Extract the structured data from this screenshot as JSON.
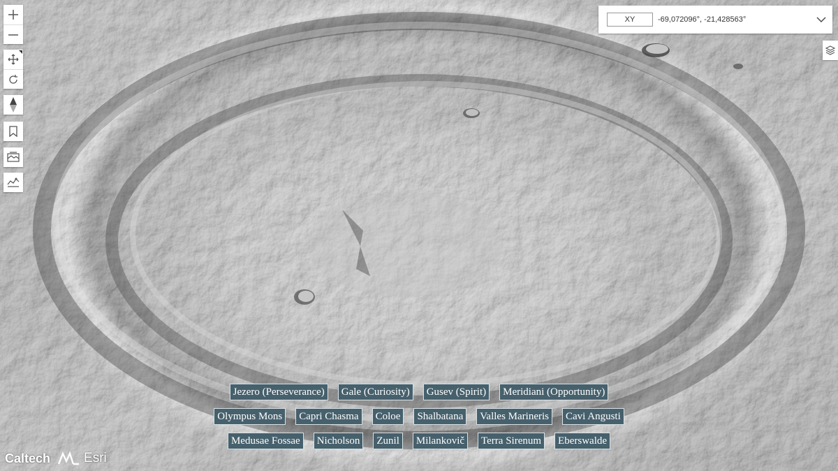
{
  "map_controls": {
    "zoom_in_icon": "plus-icon",
    "zoom_out_icon": "minus-icon",
    "pan_icon": "move-icon",
    "rotate_icon": "rotate-icon",
    "compass_icon": "compass-icon",
    "bookmark_icon": "bookmark-icon",
    "basemap_icon": "basemap-gallery-icon",
    "elevation_icon": "elevation-profile-icon"
  },
  "coordinates": {
    "format_label": "XY",
    "value": "-69,072096°, -21,428563°"
  },
  "layers_icon": "layers-icon",
  "logos": {
    "caltech": "Caltech",
    "esri": "Esri"
  },
  "locations": {
    "row1": [
      "Jezero (Perseverance)",
      "Gale (Curiosity)",
      "Gusev (Spirit)",
      "Meridiani (Opportunity)"
    ],
    "row2": [
      "Olympus Mons",
      "Capri Chasma",
      "Coloe",
      "Shalbatana",
      "Valles Marineris",
      "Cavi Angusti"
    ],
    "row3": [
      "Medusae Fossae",
      "Nicholson",
      "Zunil",
      "Milankovič",
      "Terra Sirenum",
      "Eberswalde"
    ]
  }
}
